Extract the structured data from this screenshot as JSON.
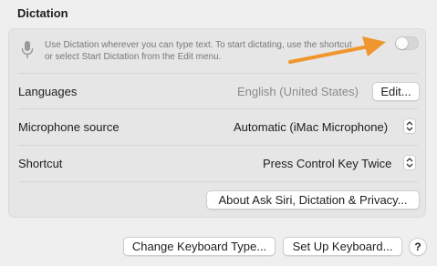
{
  "section": {
    "title": "Dictation"
  },
  "dictation": {
    "description_line1": "Use Dictation wherever you can type text. To start dictating, use the shortcut",
    "description_line2": "or select Start Dictation from the Edit menu.",
    "enabled": false
  },
  "rows": {
    "languages": {
      "label": "Languages",
      "value": "English (United States)",
      "button": "Edit..."
    },
    "microphone": {
      "label": "Microphone source",
      "value": "Automatic (iMac Microphone)"
    },
    "shortcut": {
      "label": "Shortcut",
      "value": "Press Control Key Twice"
    }
  },
  "privacy_button": "About Ask Siri, Dictation & Privacy...",
  "footer": {
    "change_keyboard_button": "Change Keyboard Type...",
    "setup_keyboard_button": "Set Up Keyboard...",
    "help_button": "?"
  },
  "colors": {
    "annotation_arrow": "#f0962e",
    "toggle_off": "#d7d7d7"
  },
  "icons": {
    "dictation": "microphone-icon",
    "stepper": "up-down-chevron-icon"
  }
}
